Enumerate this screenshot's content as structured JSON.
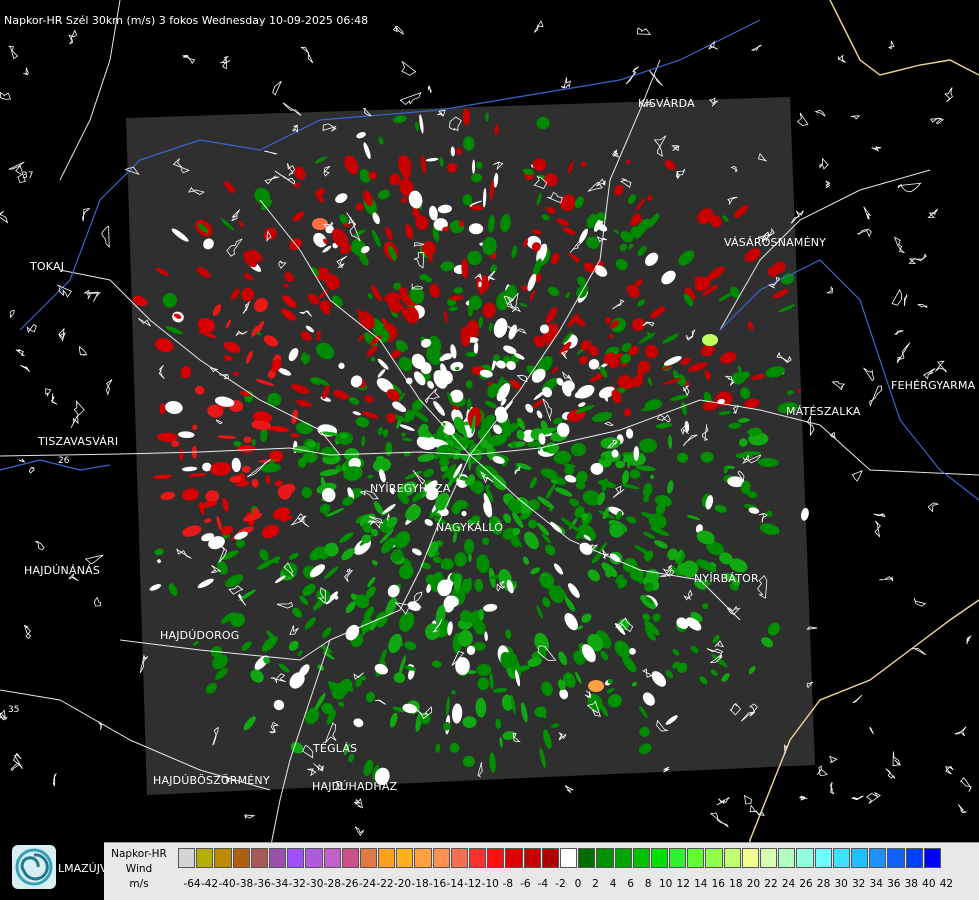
{
  "header": {
    "title": "Napkor-HR Szél 30km (m/s) 3 fokos Wednesday 10-09-2025 06:48"
  },
  "cities": [
    {
      "id": "kisvarda",
      "name": "KISVÁRDA"
    },
    {
      "id": "tokaj",
      "name": "TOKAJ"
    },
    {
      "id": "vasarosnameny",
      "name": "VÁSÁROSNAMÉNY"
    },
    {
      "id": "fehergyarmat",
      "name": "FEHÉRGYARMA"
    },
    {
      "id": "mateszalka",
      "name": "MÁTÉSZALKA"
    },
    {
      "id": "tiszavasvari",
      "name": "TISZAVASVÁRI"
    },
    {
      "id": "nyiregyhaza",
      "name": "NYÍREGYHÁZA"
    },
    {
      "id": "nagykallo",
      "name": "NAGYKÁLLÓ"
    },
    {
      "id": "hajdunanas",
      "name": "HAJDÚNÁNÁS"
    },
    {
      "id": "nyirbator",
      "name": "NYÍRBÁTOR"
    },
    {
      "id": "hajdudorog",
      "name": "HAJDÚDOROG"
    },
    {
      "id": "teglas",
      "name": "TÉGLÁS"
    },
    {
      "id": "hajduboszormeny",
      "name": "HAJDÚBÖSZÖRMÉNY"
    },
    {
      "id": "hajduhadhaz",
      "name": "HAJDÚHADHÁZ"
    },
    {
      "id": "balmazujvaros",
      "name": "LMAZÚJVÁR"
    }
  ],
  "road_labels": {
    "r26": "26",
    "r35": "35",
    "r37": "37"
  },
  "legend": {
    "title_lines": [
      "Napkor-HR",
      "Wind",
      "m/s"
    ],
    "tick_labels": [
      "-64",
      "-42",
      "-40",
      "-38",
      "-36",
      "-34",
      "-32",
      "-30",
      "-28",
      "-26",
      "-24",
      "-22",
      "-20",
      "-18",
      "-16",
      "-14",
      "-12",
      "-10",
      "-8",
      "-6",
      "-4",
      "-2",
      "0",
      "2",
      "4",
      "6",
      "8",
      "10",
      "12",
      "14",
      "16",
      "18",
      "20",
      "22",
      "24",
      "26",
      "28",
      "30",
      "32",
      "34",
      "36",
      "38",
      "40",
      "42"
    ],
    "colors": [
      "#d4d4d4",
      "#b4b000",
      "#bb8a00",
      "#b05f10",
      "#a85858",
      "#9a50a8",
      "#a050ff",
      "#b05ae0",
      "#c060c8",
      "#cc5088",
      "#e07848",
      "#ffa020",
      "#ffb020",
      "#ffa040",
      "#ff9050",
      "#f57050",
      "#ff3030",
      "#ff1010",
      "#dd0000",
      "#c80000",
      "#b00000",
      "#ffffff",
      "#006e00",
      "#009000",
      "#00a600",
      "#00c000",
      "#00e000",
      "#30f030",
      "#60ff30",
      "#90ff50",
      "#c0ff70",
      "#f0ff90",
      "#d8ffb0",
      "#b0ffc0",
      "#90ffe0",
      "#70ffff",
      "#40e0ff",
      "#20c0ff",
      "#2090ff",
      "#1060ff",
      "#0040ff",
      "#0000ff"
    ]
  }
}
